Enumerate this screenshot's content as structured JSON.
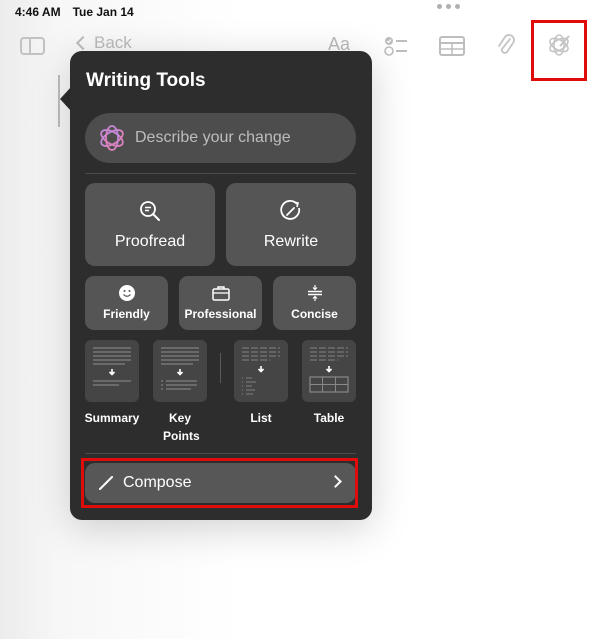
{
  "status_bar": {
    "time": "4:46 AM",
    "date": "Tue Jan 14"
  },
  "toolbar": {
    "back_label": "Back",
    "format_label": "Aa",
    "icons": [
      "sidebar-icon",
      "checklist-icon",
      "table-icon",
      "attachment-icon",
      "writing-tools-icon"
    ],
    "highlighted": "writing-tools-icon"
  },
  "writing_tools": {
    "title": "Writing Tools",
    "describe_placeholder": "Describe your change",
    "primary_actions": [
      {
        "label": "Proofread",
        "icon": "proofread-icon"
      },
      {
        "label": "Rewrite",
        "icon": "rewrite-icon"
      }
    ],
    "tone_actions": [
      {
        "label": "Friendly",
        "icon": "smiley-icon"
      },
      {
        "label": "Professional",
        "icon": "briefcase-icon"
      },
      {
        "label": "Concise",
        "icon": "concise-icon"
      }
    ],
    "format_actions": [
      {
        "label": "Summary"
      },
      {
        "label": "Key Points"
      },
      {
        "label": "List"
      },
      {
        "label": "Table"
      }
    ],
    "compose_label": "Compose"
  },
  "colors": {
    "highlight": "#e00b0b",
    "popover_bg": "#2d2d2d",
    "button_bg": "#555555"
  }
}
